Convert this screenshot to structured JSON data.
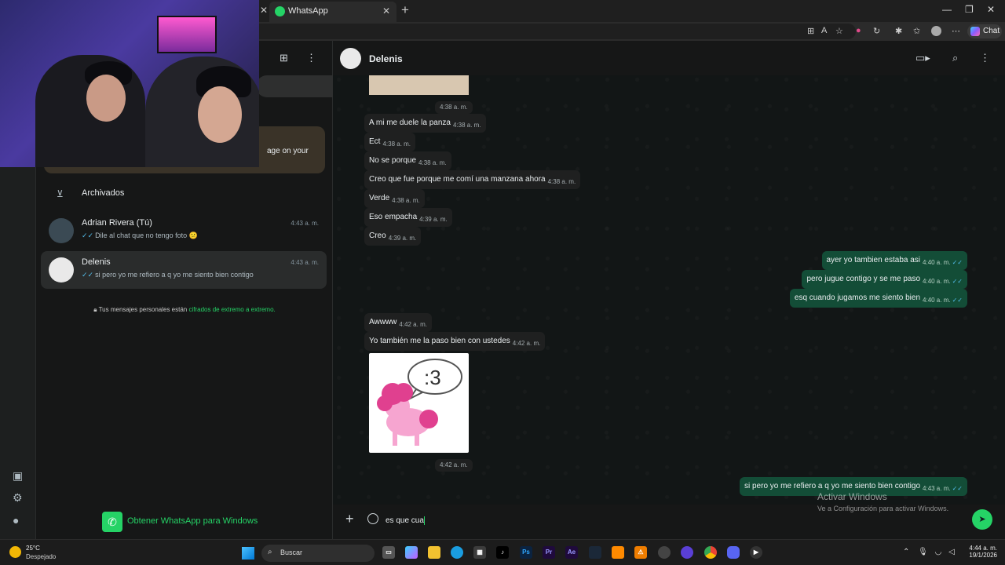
{
  "browser": {
    "tab_title": "WhatsApp",
    "chat_button": "Chat"
  },
  "sidebar": {
    "banner_text": "age on your",
    "archived_label": "Archivados",
    "chats": [
      {
        "name": "Adrian Rivera (Tú)",
        "time": "4:43 a. m.",
        "preview": "Dile al chat que no tengo foto 😕"
      },
      {
        "name": "Delenis",
        "time": "4:43 a. m.",
        "preview": "si pero yo me refiero a q yo me siento bien contigo"
      }
    ],
    "encryption_prefix": "Tus mensajes personales están ",
    "encryption_link": "cifrados de extremo a extremo.",
    "get_app": "Obtener WhatsApp para Windows"
  },
  "conversation": {
    "contact_name": "Delenis",
    "messages": [
      {
        "dir": "in",
        "text": "",
        "time": "4:38 a. m."
      },
      {
        "dir": "in",
        "text": "A mi me duele la panza",
        "time": "4:38 a. m."
      },
      {
        "dir": "in",
        "text": "Ect",
        "time": "4:38 a. m."
      },
      {
        "dir": "in",
        "text": "No se porque",
        "time": "4:38 a. m."
      },
      {
        "dir": "in",
        "text": "Creo que fue porque me comí una manzana ahora",
        "time": "4:38 a. m."
      },
      {
        "dir": "in",
        "text": "Verde",
        "time": "4:38 a. m."
      },
      {
        "dir": "in",
        "text": "Eso empacha",
        "time": "4:39 a. m."
      },
      {
        "dir": "in",
        "text": "Creo",
        "time": "4:39 a. m."
      },
      {
        "dir": "out",
        "text": "ayer yo tambien estaba asi",
        "time": "4:40 a. m."
      },
      {
        "dir": "out",
        "text": "pero jugue contigo y se me paso",
        "time": "4:40 a. m."
      },
      {
        "dir": "out",
        "text": "esq cuando jugamos me siento bien",
        "time": "4:40 a. m."
      },
      {
        "dir": "in",
        "text": "Awwww",
        "time": "4:42 a. m."
      },
      {
        "dir": "in",
        "text": "Yo también me la paso bien con ustedes",
        "time": "4:42 a. m."
      },
      {
        "dir": "in",
        "text": "",
        "time": "4:42 a. m."
      },
      {
        "dir": "out",
        "text": "si pero yo me refiero a q yo me siento bien contigo",
        "time": "4:43 a. m."
      }
    ],
    "sticker_text": ":3",
    "composer_value": "es que cua"
  },
  "watermark": {
    "line1": "Activar Windows",
    "line2": "Ve a Configuración para activar Windows."
  },
  "taskbar": {
    "temperature": "25°C",
    "condition": "Despejado",
    "search_label": "Buscar",
    "time": "4:44 a. m.",
    "date": "19/1/2026"
  },
  "colors": {
    "accent": "#25d366",
    "outgoing_bubble": "#134d37",
    "incoming_bubble": "#1f2020",
    "read_ticks": "#53bdeb"
  }
}
